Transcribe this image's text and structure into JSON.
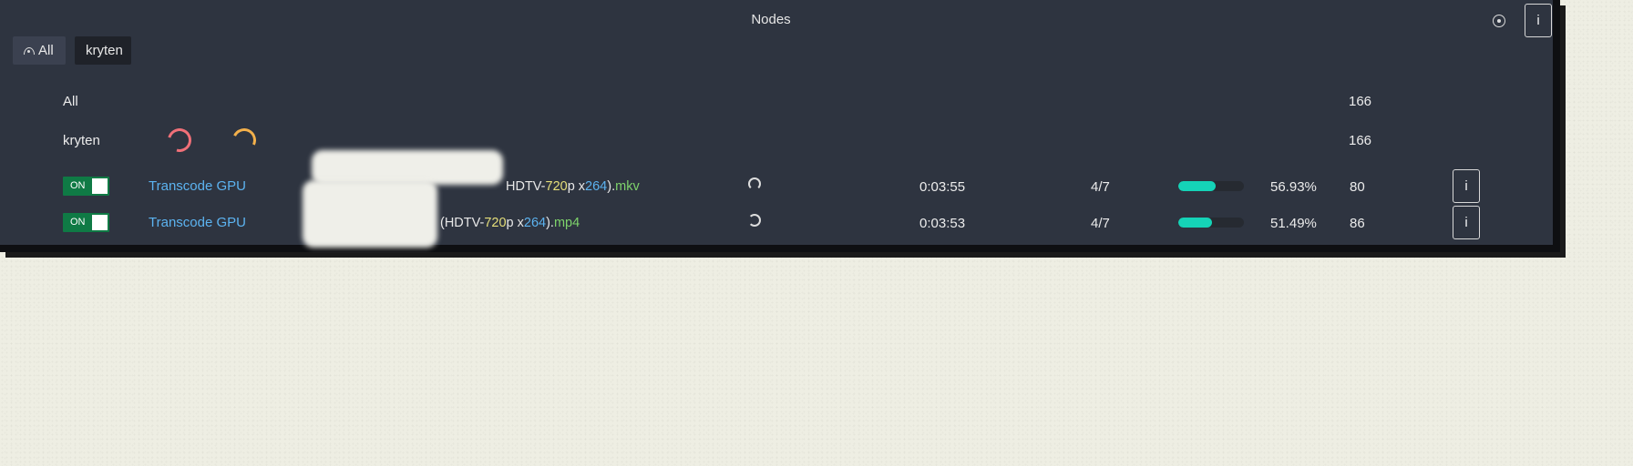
{
  "header": {
    "title": "Nodes",
    "info_label": "i"
  },
  "tabs": [
    {
      "label": "All"
    },
    {
      "label": "kryten"
    }
  ],
  "summary": [
    {
      "label": "All",
      "count": "166"
    },
    {
      "label": "kryten",
      "count": "166"
    }
  ],
  "colors": {
    "accent": "#15d3b7",
    "ring_red": "#f07078",
    "ring_orange": "#f3b04b",
    "toggle_on": "#0f7a45",
    "link": "#5cb3f0"
  },
  "workers": [
    {
      "toggle": "ON",
      "plugin": "Transcode GPU",
      "file_prefix": "HDTV-",
      "file_res": "720",
      "file_mid": "p x",
      "file_codec": "264",
      "file_close": ").",
      "file_ext": "mkv",
      "time": "0:03:55",
      "step": "4/7",
      "progress": 0.5693,
      "percent": "56.93%",
      "fps": "80",
      "info": "i"
    },
    {
      "toggle": "ON",
      "plugin": "Transcode GPU",
      "file_prefix": "(HDTV-",
      "file_res": "720",
      "file_mid": "p x",
      "file_codec": "264",
      "file_close": ").",
      "file_ext": "mp4",
      "time": "0:03:53",
      "step": "4/7",
      "progress": 0.5149,
      "percent": "51.49%",
      "fps": "86",
      "info": "i"
    }
  ]
}
